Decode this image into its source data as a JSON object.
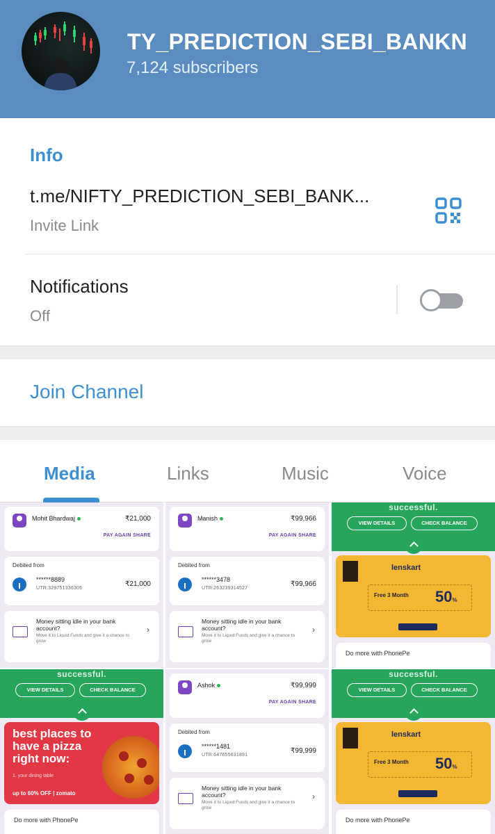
{
  "channel": {
    "title": "TY_PREDICTION_SEBI_BANKN",
    "subscribers": "7,124 subscribers"
  },
  "info": {
    "heading": "Info",
    "invite_link": "t.me/NIFTY_PREDICTION_SEBI_BANK...",
    "invite_label": "Invite Link",
    "notifications_label": "Notifications",
    "notifications_status": "Off"
  },
  "join_button": "Join Channel",
  "tabs": [
    {
      "label": "Media",
      "active": true
    },
    {
      "label": "Links",
      "active": false
    },
    {
      "label": "Music",
      "active": false
    },
    {
      "label": "Voice",
      "active": false
    }
  ],
  "media": {
    "t1": {
      "payee": "Mohit Bhardwaj",
      "amount": "₹21,000",
      "actions": "PAY AGAIN   SHARE",
      "debited": "Debited from",
      "account": "******8889",
      "utr": "UTR:329751336306",
      "account_amount": "₹21,000",
      "idle_title": "Money sitting idle in your bank account?",
      "idle_sub": "Move it to Liquid Funds and give it a chance to grow"
    },
    "t2": {
      "payee": "Manish",
      "amount": "₹99,966",
      "actions": "PAY AGAIN   SHARE",
      "debited": "Debited from",
      "account": "******3478",
      "utr": "UTR:263239314527",
      "account_amount": "₹99,966",
      "idle_title": "Money sitting idle in your bank account?",
      "idle_sub": "Move it to Liquid Funds and give it a chance to grow"
    },
    "t3": {
      "success": "successful.",
      "view_details": "VIEW DETAILS",
      "check_balance": "CHECK BALANCE",
      "brand": "lenskart",
      "offer": "Free 3 Month",
      "discount": "50",
      "do_more": "Do more with PhonePe"
    },
    "t4": {
      "success": "successful.",
      "view_details": "VIEW DETAILS",
      "check_balance": "CHECK BALANCE",
      "headline": "best places to have a pizza right now:",
      "sub": "1. your dining table",
      "footer": "up to 60% OFF | zomato",
      "do_more": "Do more with PhonePe"
    },
    "t5": {
      "payee": "Ashok",
      "amount": "₹99,999",
      "actions": "PAY AGAIN   SHARE",
      "debited": "Debited from",
      "account": "******1481",
      "utr": "UTR:647655631891",
      "account_amount": "₹99,999",
      "idle_title": "Money sitting idle in your bank account?",
      "idle_sub": "Move it to Liquid Funds and give it a chance to grow"
    },
    "t6": {
      "success": "successful.",
      "view_details": "VIEW DETAILS",
      "check_balance": "CHECK BALANCE",
      "brand": "lenskart",
      "offer": "Free 3 Month",
      "discount": "50",
      "do_more": "Do more with PhonePe"
    }
  },
  "colors": {
    "header_bg": "#5a8cbf",
    "accent": "#3d8fd1",
    "phonepe_purple": "#6a3fb0",
    "success_green": "#27a55c"
  },
  "icons": [
    "qr-code-icon",
    "toggle-switch",
    "sbi-bank-icon",
    "chevron-right-icon",
    "chevron-up-icon"
  ]
}
